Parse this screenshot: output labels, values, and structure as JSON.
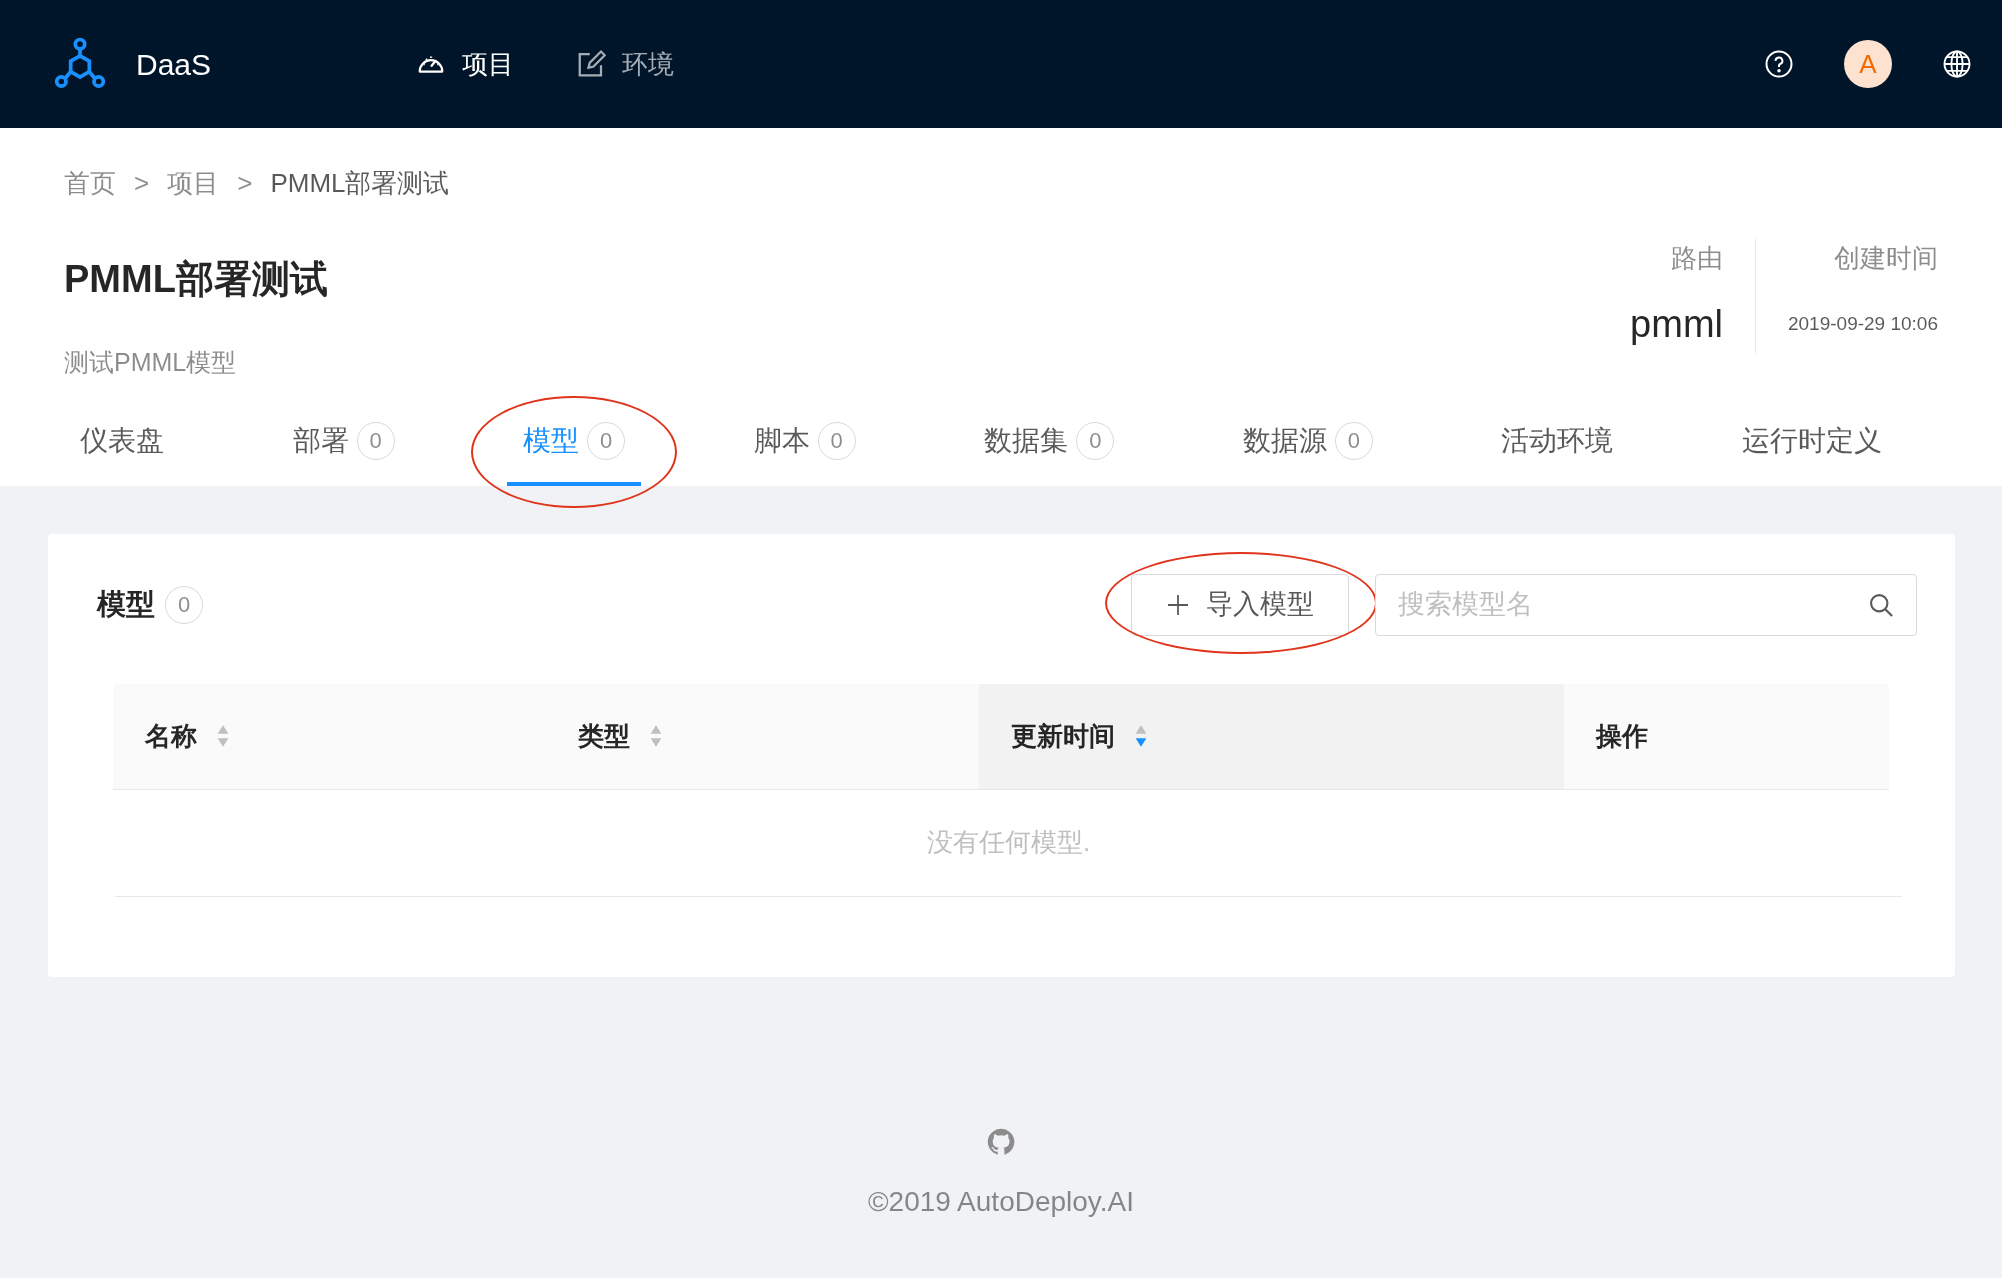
{
  "header": {
    "brand": "DaaS",
    "nav": [
      {
        "label": "项目",
        "selected": true
      },
      {
        "label": "环境",
        "selected": false
      }
    ],
    "avatar": "A"
  },
  "breadcrumb": {
    "items": [
      "首页",
      "项目",
      "PMML部署测试"
    ],
    "separator": ">"
  },
  "project": {
    "title": "PMML部署测试",
    "description": "测试PMML模型",
    "stats": [
      {
        "label": "路由",
        "value": "pmml",
        "kind": "large"
      },
      {
        "label": "创建时间",
        "value": "2019-09-29 10:06",
        "kind": "small"
      }
    ]
  },
  "tabs": [
    {
      "label": "仪表盘",
      "selected": false,
      "circled": false
    },
    {
      "label": "部署",
      "count": "0",
      "selected": false,
      "circled": false
    },
    {
      "label": "模型",
      "count": "0",
      "selected": true,
      "circled": true
    },
    {
      "label": "脚本",
      "count": "0",
      "selected": false,
      "circled": false
    },
    {
      "label": "数据集",
      "count": "0",
      "selected": false,
      "circled": false
    },
    {
      "label": "数据源",
      "count": "0",
      "selected": false,
      "circled": false
    },
    {
      "label": "活动环境",
      "selected": false,
      "circled": false
    },
    {
      "label": "运行时定义",
      "selected": false,
      "circled": false
    }
  ],
  "panel": {
    "title": "模型",
    "count": "0",
    "import_button": {
      "label": "导入模型",
      "circled": true
    },
    "search": {
      "placeholder": "搜索模型名"
    },
    "table": {
      "columns": [
        {
          "label": "名称",
          "sortable": true,
          "sorted": false
        },
        {
          "label": "类型",
          "sortable": true,
          "sorted": false
        },
        {
          "label": "更新时间",
          "sortable": true,
          "sorted": true
        },
        {
          "label": "操作",
          "sortable": false
        }
      ],
      "empty_text": "没有任何模型."
    }
  },
  "footer": {
    "copyright": "©2019 AutoDeploy.AI"
  }
}
